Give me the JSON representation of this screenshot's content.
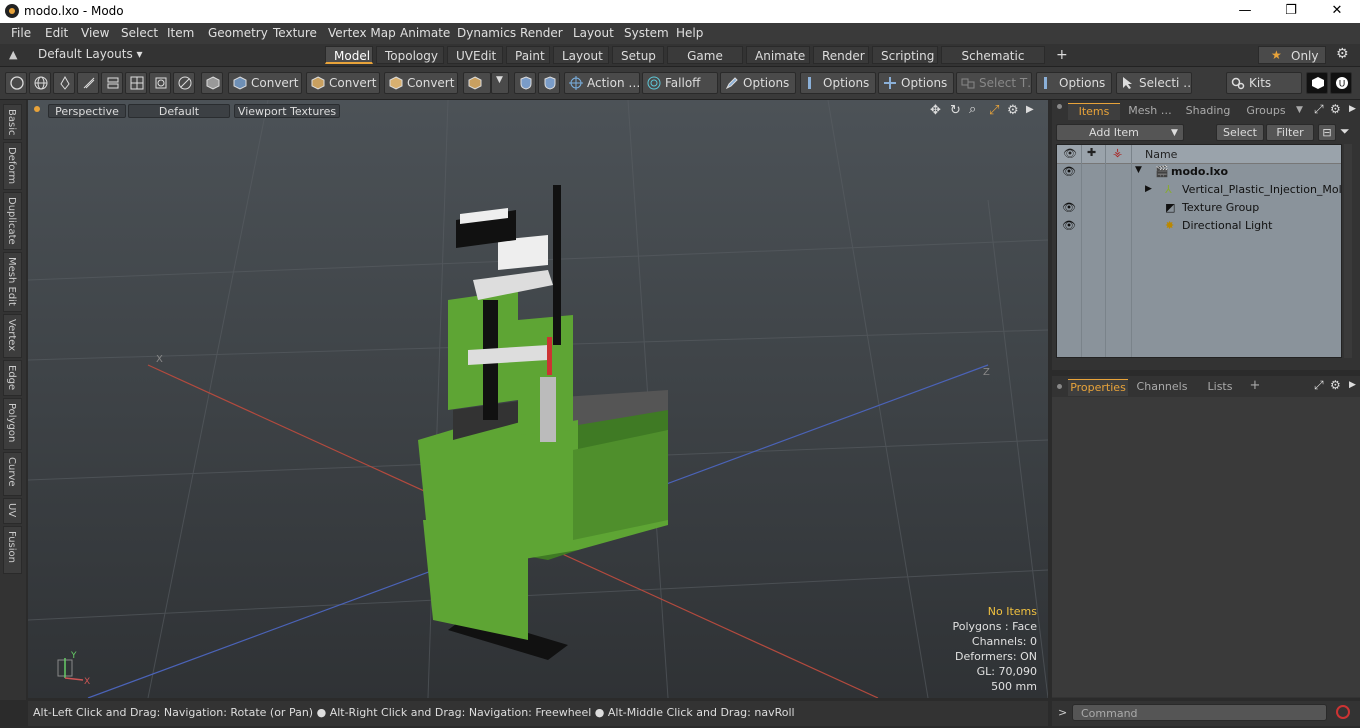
{
  "window": {
    "title": "modo.lxo - Modo",
    "minimize": "—",
    "maximize": "❐",
    "close": "✕"
  },
  "menu": [
    "File",
    "Edit",
    "View",
    "Select",
    "Item",
    "Geometry",
    "Texture",
    "Vertex Map",
    "Animate",
    "Dynamics",
    "Render",
    "Layout",
    "System",
    "Help"
  ],
  "layouts": {
    "label": "Default Layouts ▾",
    "only": "Only"
  },
  "tabs": [
    {
      "label": "Model",
      "active": true
    },
    {
      "label": "Topology"
    },
    {
      "label": "UVEdit"
    },
    {
      "label": "Paint"
    },
    {
      "label": "Layout"
    },
    {
      "label": "Setup"
    },
    {
      "label": "Game Tools"
    },
    {
      "label": "Animate"
    },
    {
      "label": "Render"
    },
    {
      "label": "Scripting"
    },
    {
      "label": "Schematic Fusion"
    },
    {
      "label": "+"
    }
  ],
  "toolbar": {
    "convert1": "Convert",
    "convert2": "Convert",
    "convert3": "Convert",
    "action": "Action …",
    "falloff": "Falloff",
    "options1": "Options",
    "options2": "Options",
    "options3": "Options",
    "select_t": "Select T…",
    "options4": "Options",
    "selecti": "Selecti …",
    "kits": "Kits"
  },
  "sidetabs": [
    "Basic",
    "Deform",
    "Duplicate",
    "Mesh Edit",
    "Vertex",
    "Edge",
    "Polygon",
    "Curve",
    "UV",
    "Fusion"
  ],
  "viewport": {
    "perspective": "Perspective",
    "default": "Default",
    "textures": "Viewport Textures",
    "axis_x": "X",
    "axis_z": "Z",
    "gizmo_y": "Y",
    "gizmo_x": "X",
    "info": {
      "no_items": "No Items",
      "polygons": "Polygons : Face",
      "channels": "Channels: 0",
      "deformers": "Deformers: ON",
      "gl": "GL: 70,090",
      "scale": "500 mm"
    }
  },
  "status": "Alt-Left Click and Drag: Navigation: Rotate (or Pan) ● Alt-Right Click and Drag: Navigation: Freewheel ● Alt-Middle Click and Drag: navRoll",
  "command": {
    "prompt": ">",
    "placeholder": "Command"
  },
  "items_panel": {
    "tabs": [
      "Items",
      "Mesh …",
      "Shading",
      "Groups"
    ],
    "add_item": "Add Item",
    "select": "Select",
    "filter": "Filter",
    "col_name": "Name",
    "rows": [
      {
        "name": "modo.lxo",
        "bold": true
      },
      {
        "name": "Vertical_Plastic_Injection_Mol …"
      },
      {
        "name": "Texture Group"
      },
      {
        "name": "Directional Light"
      }
    ]
  },
  "props_panel": {
    "tabs": [
      "Properties",
      "Channels",
      "Lists",
      "+"
    ]
  },
  "colors": {
    "accent": "#e8a33a",
    "machine_green": "#5ea534"
  }
}
